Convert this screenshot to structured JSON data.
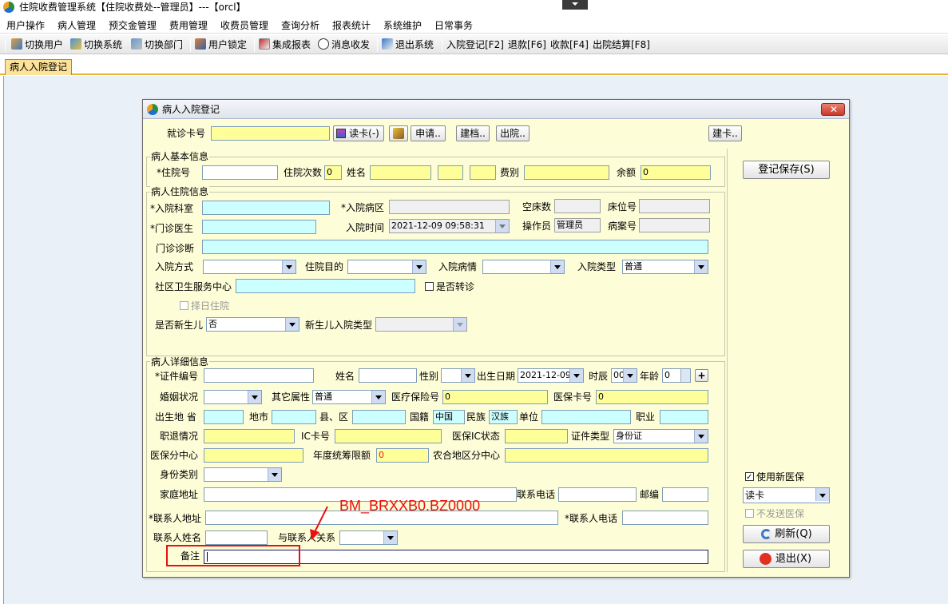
{
  "window": {
    "title": "住院收费管理系统【住院收费处--管理员】---【orcl】"
  },
  "menu": [
    "用户操作",
    "病人管理",
    "预交金管理",
    "费用管理",
    "收费员管理",
    "查询分析",
    "报表统计",
    "系统维护",
    "日常事务"
  ],
  "toolbar": {
    "switch_user": "切换用户",
    "switch_system": "切换系统",
    "switch_dept": "切换部门",
    "lock_user": "用户锁定",
    "integrated_report": "集成报表",
    "messages": "消息收发",
    "exit_system": "退出系统",
    "admission": "入院登记[F2]",
    "refund": "退款[F6]",
    "collect": "收款[F4]",
    "discharge": "出院结算[F8]"
  },
  "tab": {
    "label": "病人入院登记"
  },
  "dialog": {
    "title": "病人入院登记",
    "top": {
      "card_label": "就诊卡号",
      "read_card": "读卡(-)",
      "apply": "申请..",
      "create_file": "建档..",
      "discharge": "出院..",
      "create_card": "建卡.."
    },
    "basic": {
      "legend": "病人基本信息",
      "inpatient_no_label": "*住院号",
      "times_label": "住院次数",
      "times_value": "0",
      "name_label": "姓名",
      "fee_type_label": "费别",
      "balance_label": "余额",
      "balance_value": "0"
    },
    "stay": {
      "legend": "病人住院信息",
      "dept_label": "*入院科室",
      "ward_label": "*入院病区",
      "empty_beds_label": "空床数",
      "bed_no_label": "床位号",
      "doctor_label": "*门诊医生",
      "admit_time_label": "入院时间",
      "admit_time_value": "2021-12-09 09:58:31",
      "operator_label": "操作员",
      "operator_value": "管理员",
      "case_no_label": "病案号",
      "diagnosis_label": "门诊诊断",
      "admit_way_label": "入院方式",
      "purpose_label": "住院目的",
      "condition_label": "入院病情",
      "admit_type_label": "入院类型",
      "admit_type_value": "普通",
      "community_label": "社区卫生服务中心",
      "transfer_label": "是否转诊",
      "select_day_label": "择日住院",
      "newborn_label": "是否新生儿",
      "newborn_value": "否",
      "newborn_type_label": "新生儿入院类型"
    },
    "detail": {
      "legend": "病人详细信息",
      "id_no_label": "*证件编号",
      "name_label": "姓名",
      "sex_label": "性别",
      "birth_label": "出生日期",
      "birth_value": "2021-12-09",
      "hour_label": "时辰",
      "hour_value": "00",
      "age_label": "年龄",
      "age_value": "0",
      "marital_label": "婚姻状况",
      "other_attr_label": "其它属性",
      "other_attr_value": "普通",
      "medical_ins_label": "医疗保险号",
      "medical_ins_value": "0",
      "ins_card_label": "医保卡号",
      "ins_card_value": "0",
      "birthplace_label": "出生地 省",
      "city_label": "地市",
      "county_label": "县、区",
      "nationality_label": "国籍",
      "nationality_value": "中国",
      "ethnicity_label": "民族",
      "ethnicity_value": "汉族",
      "unit_label": "单位",
      "job_label": "职业",
      "retire_label": "职退情况",
      "ic_label": "IC卡号",
      "ic_status_label": "医保IC状态",
      "id_type_label": "证件类型",
      "id_type_value": "身份证",
      "ins_center_label": "医保分中心",
      "annual_limit_label": "年度统筹限额",
      "annual_limit_value": "0",
      "rural_label": "农合地区分中心",
      "identity_label": "身份类别",
      "address_label": "家庭地址",
      "phone_label": "联系电话",
      "zip_label": "邮编",
      "contact_addr_label": "*联系人地址",
      "contact_phone_label": "*联系人电话",
      "contact_name_label": "联系人姓名",
      "relation_label": "与联系人关系",
      "remark_label": "备注"
    },
    "side": {
      "save": "登记保存(S)",
      "new_ins_label": "使用新医保",
      "read_card_value": "读卡",
      "no_send_label": "不发送医保",
      "refresh": "刷新(Q)",
      "exit": "退出(X)"
    }
  },
  "annotation": {
    "text": "BM_BRXXB0.BZ0000",
    "color": "#e81010"
  }
}
